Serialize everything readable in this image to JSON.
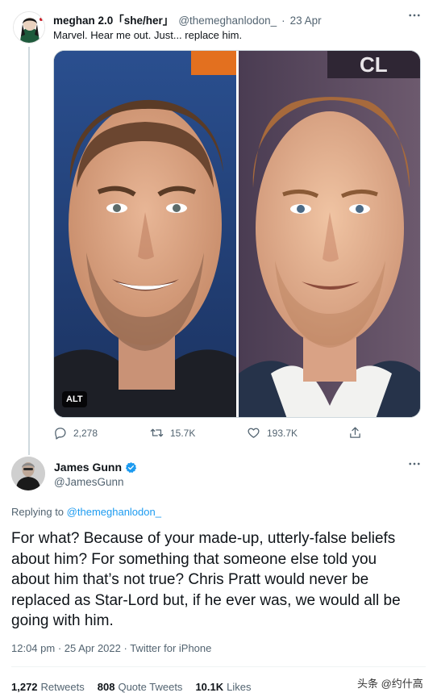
{
  "parent_tweet": {
    "name": "meghan 2.0「she/her」",
    "handle": "@themeghanlodon_",
    "dot": "·",
    "date": "23 Apr",
    "text": "Marvel. Hear me out. Just... replace him.",
    "media_alt_badge": "ALT",
    "actions": {
      "replies": "2,278",
      "retweets": "15.7K",
      "likes": "193.7K"
    }
  },
  "reply_tweet": {
    "name": "James Gunn",
    "handle": "@JamesGunn",
    "replying_prefix": "Replying to",
    "replying_to": "@themeghanlodon_",
    "text": "For what? Because of your made-up, utterly-false beliefs about him? For something that someone else told you about him that’s not true? Chris Pratt would never be replaced as Star-Lord but, if he ever was, we would all be going with him.",
    "timestamp": "12:04 pm · 25 Apr 2022 · ",
    "source": "Twitter for iPhone",
    "stats": {
      "retweets_count": "1,272",
      "retweets_label": "Retweets",
      "quotes_count": "808",
      "quotes_label": "Quote Tweets",
      "likes_count": "10.1K",
      "likes_label": "Likes"
    }
  },
  "watermark": "头条 @约什高",
  "icons": {
    "more": "more-icon",
    "reply": "reply-icon",
    "retweet": "retweet-icon",
    "like": "heart-icon",
    "share": "share-icon",
    "verified": "verified-badge-icon"
  },
  "colors": {
    "accent": "#1d9bf0",
    "secondary_text": "#536471",
    "primary_text": "#0f1419",
    "divider": "#eff3f4"
  }
}
